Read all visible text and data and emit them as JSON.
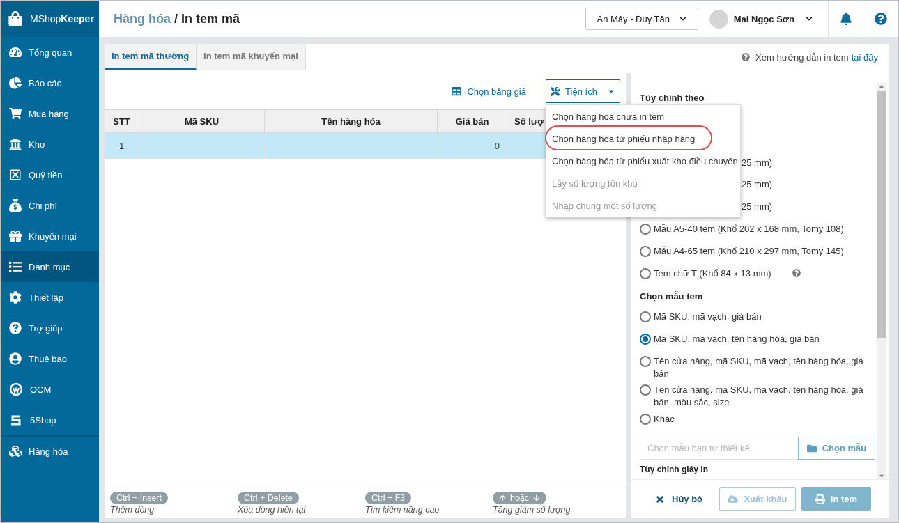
{
  "logo": {
    "light": "MShop",
    "bold": "Keeper"
  },
  "sidebar": {
    "items": [
      {
        "label": "Tổng quan",
        "selected": false
      },
      {
        "label": "Báo cáo",
        "selected": false
      },
      {
        "label": "Mua hàng",
        "selected": false
      },
      {
        "label": "Kho",
        "selected": false
      },
      {
        "label": "Quỹ tiền",
        "selected": false
      },
      {
        "label": "Chi phí",
        "selected": false
      },
      {
        "label": "Khuyến mại",
        "selected": false
      },
      {
        "label": "Danh mục",
        "selected": true
      },
      {
        "label": "Thiết lập",
        "selected": false
      },
      {
        "label": "Trợ giúp",
        "selected": false
      },
      {
        "label": "Thuê bao",
        "selected": false
      },
      {
        "label": "OCM",
        "selected": false
      },
      {
        "label": "5Shop",
        "selected": false
      },
      {
        "label": "Hàng hóa",
        "selected": false
      }
    ]
  },
  "header": {
    "breadcrumb_parent": "Hàng hóa",
    "breadcrumb_separator": "/",
    "title": "In tem mã",
    "store": "An Mây - Duy Tân",
    "user": "Mai Ngọc Sơn"
  },
  "tabs": [
    {
      "label": "In tem mã thường",
      "selected": true
    },
    {
      "label": "In tem mã khuyến mại",
      "selected": false
    }
  ],
  "guide": {
    "text": "Xem hướng dẫn in tem",
    "link": "tại đây"
  },
  "toolbar": {
    "price_table": "Chọn bảng giá",
    "utilities": "Tiện ích"
  },
  "utilities_menu": [
    {
      "label": "Chọn hàng hóa chưa in tem",
      "disabled": false,
      "circled": false
    },
    {
      "label": "Chọn hàng hóa từ phiếu nhập hàng",
      "disabled": false,
      "circled": true
    },
    {
      "label": "Chọn hàng hóa từ phiếu xuất kho điều chuyển",
      "disabled": false,
      "circled": false
    },
    {
      "label": "Lấy số lượng tồn kho",
      "disabled": true,
      "circled": false
    },
    {
      "label": "Nhập chung một số lượng",
      "disabled": true,
      "circled": false
    }
  ],
  "table": {
    "columns": [
      "STT",
      "Mã SKU",
      "Tên hàng hóa",
      "Giá bán",
      "Số lượ"
    ],
    "rows": [
      {
        "stt": "1",
        "price": "0",
        "selected": true
      }
    ]
  },
  "settings": {
    "heading": "Tùy chỉnh theo",
    "sizes": [
      {
        "kind": "covered",
        "label": "25 mm)"
      },
      {
        "kind": "covered",
        "label": "25 mm)"
      },
      {
        "kind": "covered",
        "label": "25 mm)"
      },
      {
        "kind": "radio",
        "label": "Mẫu A5-40 tem (Khổ 202 x 168 mm, Tomy 108)",
        "selected": false,
        "help": false
      },
      {
        "kind": "radio",
        "label": "Mẫu A4-65 tem (Khổ 210 x 297 mm, Tomy 145)",
        "selected": false,
        "help": false
      },
      {
        "kind": "radio",
        "label": "Tem chữ T (Khổ 84 x 13 mm)",
        "selected": false,
        "help": true
      }
    ],
    "template_heading": "Chọn mẫu tem",
    "templates": [
      {
        "label": "Mã SKU, mã vạch, giá bán",
        "selected": false
      },
      {
        "label": "Mã SKU, mã vạch, tên hàng hóa, giá bán",
        "selected": true
      },
      {
        "label": "Tên cửa hàng, mã SKU, mã vạch, tên hàng hóa, giá bán",
        "selected": false
      },
      {
        "label": "Tên cửa hàng, mã SKU, mã vạch, tên hàng hóa, giá bán, màu sắc, size",
        "selected": false
      },
      {
        "label": "Khác",
        "selected": false
      }
    ],
    "custom_placeholder": "Chọn mẫu bạn tự thiết kế",
    "choose_button": "Chọn mẫu",
    "paper_heading": "Tùy chỉnh giấy in"
  },
  "actions": {
    "cancel": "Hủy bỏ",
    "export": {
      "label": "Xuất khẩu",
      "disabled": true
    },
    "print": {
      "label": "In tem",
      "disabled": true
    }
  },
  "hints": [
    {
      "kind": "keys",
      "keys": "Ctrl + Insert",
      "text": "Thêm dòng"
    },
    {
      "kind": "keys",
      "keys": "Ctrl + Delete",
      "text": "Xóa dòng hiện tại"
    },
    {
      "kind": "keys",
      "keys": "Ctrl + F3",
      "text": "Tìm kiếm nâng cao"
    },
    {
      "kind": "arrows",
      "keys": "hoặc",
      "text": "Tăng giảm số lượng"
    }
  ]
}
